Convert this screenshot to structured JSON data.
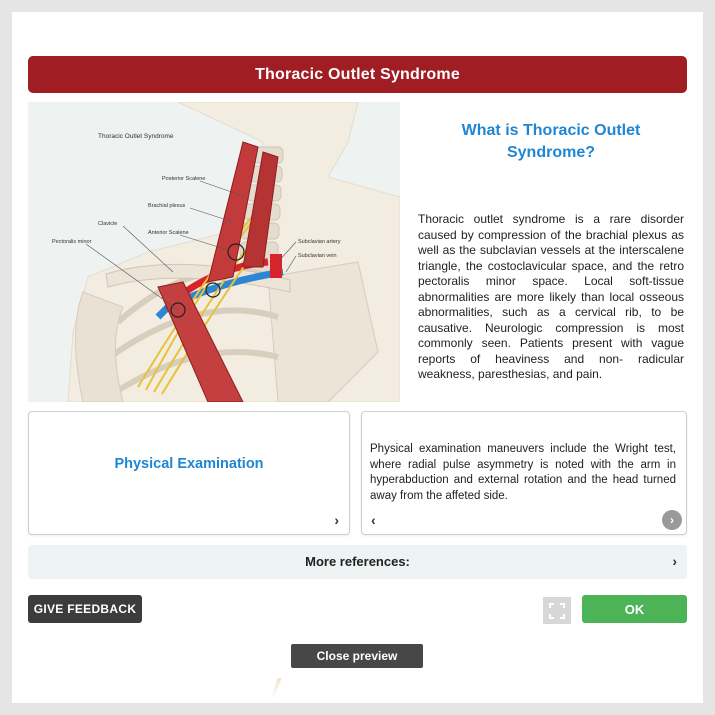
{
  "header": {
    "title": "Thoracic Outlet Syndrome"
  },
  "illustration": {
    "title": "Thoracic Outlet Syndrome",
    "labels": {
      "posterior_scalene": "Posterior Scalene",
      "brachial_plexus": "Brachial plexus",
      "clavicle": "Clavicle",
      "anterior_scalene": "Anterior Scalene",
      "pectoralis_minor": "Pectoralis minor",
      "subclavian_artery": "Subclavian artery",
      "subclavian_vein": "Subclavian vein"
    }
  },
  "intro": {
    "heading": "What is Thoracic Outlet Syndrome?",
    "body": "Thoracic outlet syndrome is a rare disorder caused by compression of the brachial plexus as well as the subclavian vessels at the interscalene triangle, the costoclavicular space, and the retro pectoralis minor space. Local soft-tissue abnormalities are more likely than local osseous abnormalities, such as a cervical rib, to be causative. Neurologic compression is most commonly seen. Patients present with vague reports of heaviness and non- radicular weakness, paresthesias, and pain."
  },
  "cards": {
    "left_title": "Physical Examination",
    "right_text": "Physical examination maneuvers include the Wright test, where radial pulse asymmetry is noted with the arm in hyperabduction and external rotation and the head turned away from the affeted side."
  },
  "references": {
    "label": "More references:"
  },
  "footer": {
    "feedback_label": "GIVE FEEDBACK",
    "ok_label": "OK",
    "close_label": "Close preview"
  },
  "colors": {
    "title_bar": "#a01d23",
    "heading_blue": "#1f86d3",
    "ok_green": "#4cb456",
    "feedback_dark": "#3c3c3c"
  },
  "icons": [
    "chevron-right-icon",
    "chevron-left-icon",
    "expand-icon"
  ]
}
